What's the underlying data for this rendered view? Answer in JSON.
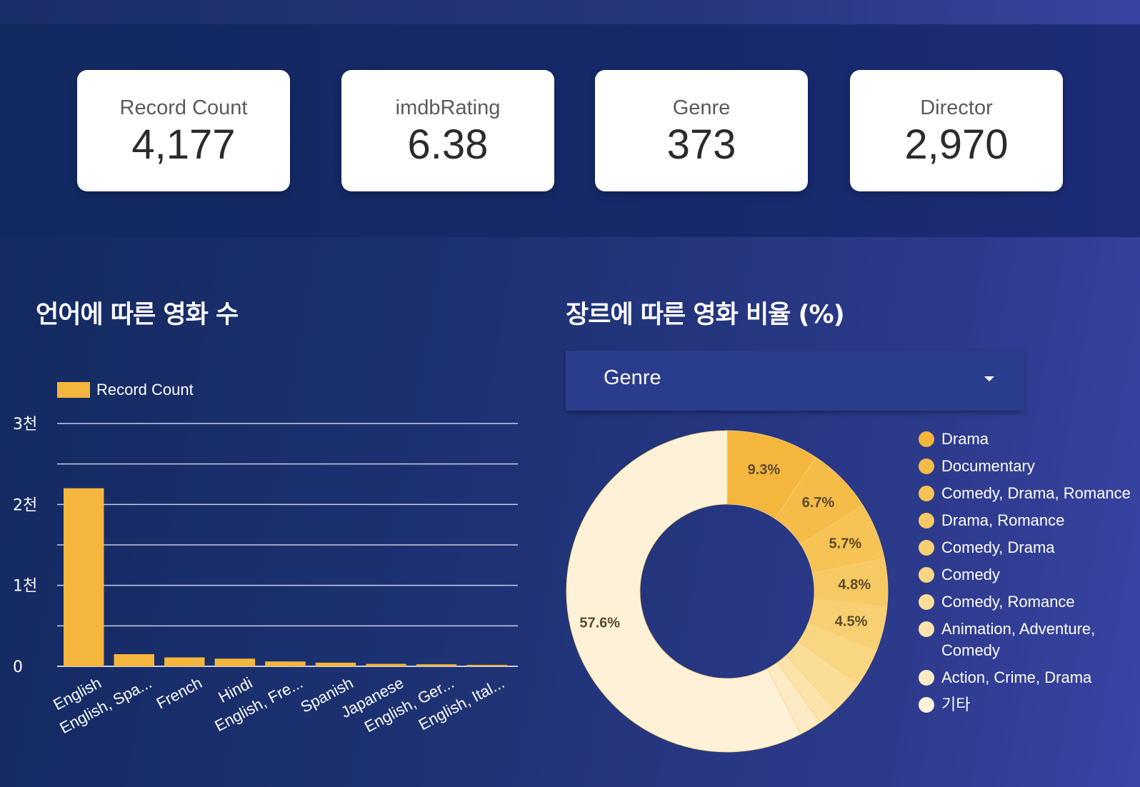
{
  "kpis": [
    {
      "label": "Record Count",
      "value": "4,177"
    },
    {
      "label": "imdbRating",
      "value": "6.38"
    },
    {
      "label": "Genre",
      "value": "373"
    },
    {
      "label": "Director",
      "value": "2,970"
    }
  ],
  "bar_section": {
    "title": "언어에 따른 영화 수"
  },
  "pie_section": {
    "title": "장르에 따른 영화 비율 (%)",
    "dropdown_value": "Genre"
  },
  "colors": {
    "bar": "#f4b63d",
    "grid": "#c9cde6",
    "text": "#ffffff"
  },
  "chart_data": [
    {
      "type": "bar",
      "legend": "Record Count",
      "categories": [
        "English",
        "English, Spa...",
        "French",
        "Hindi",
        "English, Fre...",
        "Spanish",
        "Japanese",
        "English, Ger...",
        "English, Ital..."
      ],
      "values": [
        2200,
        150,
        110,
        95,
        60,
        45,
        30,
        25,
        18
      ],
      "ylim": [
        0,
        3000
      ],
      "yticks": [
        {
          "value": 0,
          "label": "0"
        },
        {
          "value": 1000,
          "label": "1천"
        },
        {
          "value": 2000,
          "label": "2천"
        },
        {
          "value": 3000,
          "label": "3천"
        }
      ],
      "minor_gridlines": [
        500,
        1500,
        2500
      ],
      "grid": true,
      "legend_position": "top-left"
    },
    {
      "type": "pie",
      "donut": true,
      "slices": [
        {
          "label": "Drama",
          "value": 9.3,
          "text": "9.3%",
          "color": "#f4b63d"
        },
        {
          "label": "Documentary",
          "value": 6.7,
          "text": "6.7%",
          "color": "#f5bc48"
        },
        {
          "label": "Comedy, Drama, Romance",
          "value": 5.7,
          "text": "5.7%",
          "color": "#f6c354"
        },
        {
          "label": "Drama, Romance",
          "value": 4.8,
          "text": "4.8%",
          "color": "#f7c962"
        },
        {
          "label": "Comedy, Drama",
          "value": 4.5,
          "text": "4.5%",
          "color": "#f8cf72"
        },
        {
          "label": "Comedy",
          "value": 3.8,
          "text": "",
          "color": "#f9d682"
        },
        {
          "label": "Comedy, Romance",
          "value": 3.4,
          "text": "",
          "color": "#fadd97"
        },
        {
          "label": "Animation, Adventure, Comedy",
          "value": 2.0,
          "text": "",
          "color": "#fbe3ab"
        },
        {
          "label": "Action, Crime, Drama",
          "value": 2.2,
          "text": "",
          "color": "#fcebc4"
        },
        {
          "label": "기타",
          "value": 57.6,
          "text": "57.6%",
          "color": "#fdf1d8"
        }
      ],
      "legend_position": "right"
    }
  ]
}
